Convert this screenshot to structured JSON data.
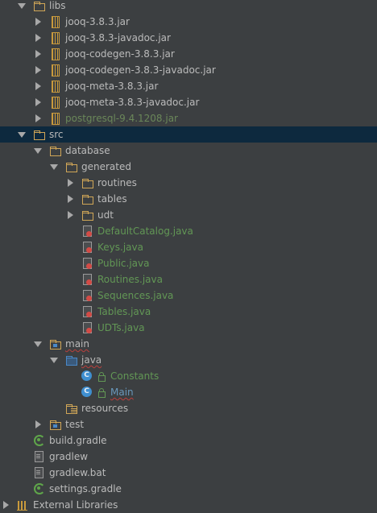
{
  "tree": {
    "libs": {
      "label": "libs",
      "jars": [
        "jooq-3.8.3.jar",
        "jooq-3.8.3-javadoc.jar",
        "jooq-codegen-3.8.3.jar",
        "jooq-codegen-3.8.3-javadoc.jar",
        "jooq-meta-3.8.3.jar",
        "jooq-meta-3.8.3-javadoc.jar",
        "postgresql-9.4.1208.jar"
      ]
    },
    "src": {
      "label": "src",
      "database": {
        "label": "database",
        "generated": {
          "label": "generated",
          "folders": [
            "routines",
            "tables",
            "udt"
          ],
          "files": [
            "DefaultCatalog.java",
            "Keys.java",
            "Public.java",
            "Routines.java",
            "Sequences.java",
            "Tables.java",
            "UDTs.java"
          ]
        }
      },
      "main": {
        "label": "main",
        "java": {
          "label": "java",
          "classes": [
            "Constants",
            "Main"
          ]
        },
        "resources": "resources"
      },
      "test": "test"
    },
    "root_files": [
      "build.gradle",
      "gradlew",
      "gradlew.bat",
      "settings.gradle"
    ],
    "external_libraries": "External Libraries"
  },
  "colors": {
    "background": "#3c3f41",
    "selection": "#0d293e",
    "text": "#bbbbbb",
    "generated_text": "#629755",
    "folder": "#d0a657",
    "source_folder": "#4a88c7"
  }
}
